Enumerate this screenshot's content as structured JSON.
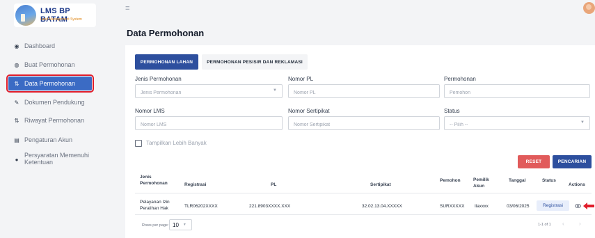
{
  "brand": {
    "title": "LMS BP BATAM",
    "subtitle": "Land Management System"
  },
  "sidebar": {
    "items": [
      {
        "label": "Dashboard",
        "icon": "dashboard-icon"
      },
      {
        "label": "Buat Permohonan",
        "icon": "globe-icon"
      },
      {
        "label": "Data Permohonan",
        "icon": "sync-icon",
        "active": true
      },
      {
        "label": "Dokumen Pendukung",
        "icon": "pencil-icon"
      },
      {
        "label": "Riwayat Permohonan",
        "icon": "history-icon"
      },
      {
        "label": "Pengaturan Akun",
        "icon": "settings-icon"
      },
      {
        "label": "Persyaratan Memenuhi",
        "label2": "Ketentuan",
        "icon": "info-icon"
      }
    ]
  },
  "page": {
    "title": "Data Permohonan"
  },
  "tabs": [
    {
      "label": "PERMOHONAN LAHAN",
      "active": true
    },
    {
      "label": "PERMOHONAN PESISIR DAN REKLAMASI",
      "active": false
    }
  ],
  "filters": {
    "jenis_label": "Jenis Permohonan",
    "jenis_placeholder": "Jenis Permohonan",
    "nomor_pl_label": "Nomor PL",
    "nomor_pl_placeholder": "Nomor PL",
    "pemohon_label": "Permohonan",
    "pemohon_placeholder": "Pemohon",
    "nomor_lms_label": "Nomor LMS",
    "nomor_lms_placeholder": "Nomor LMS",
    "nomor_sertipikat_label": "Nomor Sertipikat",
    "nomor_sertipikat_placeholder": "Nomor Sertipikat",
    "status_label": "Status",
    "status_placeholder": "-- Pilih --",
    "show_more_label": "Tampilkan Lebih Banyak"
  },
  "actions": {
    "reset_label": "RESET",
    "search_label": "PENCARIAN"
  },
  "table": {
    "headers": {
      "jenis_1": "Jenis",
      "jenis_2": "Permohonan",
      "registrasi": "Registrasi",
      "pl": "PL",
      "sertipikat": "Sertipikat",
      "pemohon": "Pemohon",
      "pemilik_1": "Pemilik",
      "pemilik_2": "Akun",
      "tanggal": "Tanggal",
      "status": "Status",
      "actions": "Actions"
    },
    "rows": [
      {
        "jenis_1": "Pelayanan Izin",
        "jenis_2": "Peralihan Hak",
        "registrasi": "TLR06202XXXX",
        "pl": "221.8903XXXX.XXX",
        "sertipikat": "32.02.13.04.XXXXX",
        "pemohon": "SURXXXXX",
        "pemilik": "Ilaxxxx",
        "tanggal": "03/06/2025",
        "status": "Registrasi"
      }
    ]
  },
  "pagination": {
    "rows_per_page_label": "Rows per page:",
    "rows_per_page_value": "10",
    "range_label": "1-1 of 1"
  },
  "colors": {
    "primary": "#2d4f9e",
    "sidebar_active": "#3b6bc4",
    "reset": "#e15b5b",
    "highlight": "#e11d2a"
  }
}
